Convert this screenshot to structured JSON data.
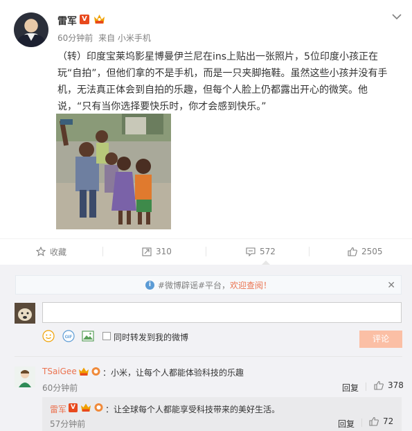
{
  "post": {
    "author": "雷军",
    "verified_badge": "V",
    "time": "60分钟前",
    "source": "来自 小米手机",
    "text": "（转）印度宝莱坞影星博曼伊兰尼在ins上贴出一张照片，5位印度小孩正在玩“自拍”，但他们拿的不是手机，而是一只夹脚拖鞋。虽然这些小孩并没有手机，无法真正体会到自拍的乐趣，但每个人脸上仍都露出开心的微笑。他说，“只有当你选择要快乐时，你才会感到快乐。”"
  },
  "actions": {
    "favorite_label": "收藏",
    "repost_count": "310",
    "comment_count": "572",
    "like_count": "2505"
  },
  "comment_box": {
    "notice_text": "#微博辟谣#平台，",
    "notice_link": "欢迎查阅！",
    "repost_option": "同时转发到我的微博",
    "submit_label": "评论"
  },
  "comments": [
    {
      "author": "TSaiGee",
      "text": "：小米，让每个人都能体验科技的乐趣",
      "time": "60分钟前",
      "reply_label": "回复",
      "likes": "378"
    }
  ],
  "reply": {
    "author": "雷军",
    "verified_badge": "V",
    "text": "：让全球每个人都能享受科技带来的美好生活。",
    "time": "57分钟前",
    "reply_label": "回复",
    "likes": "72"
  },
  "colors": {
    "accent": "#eb7350",
    "verified": "#e8491d",
    "submit_disabled": "#fbbfa5"
  }
}
